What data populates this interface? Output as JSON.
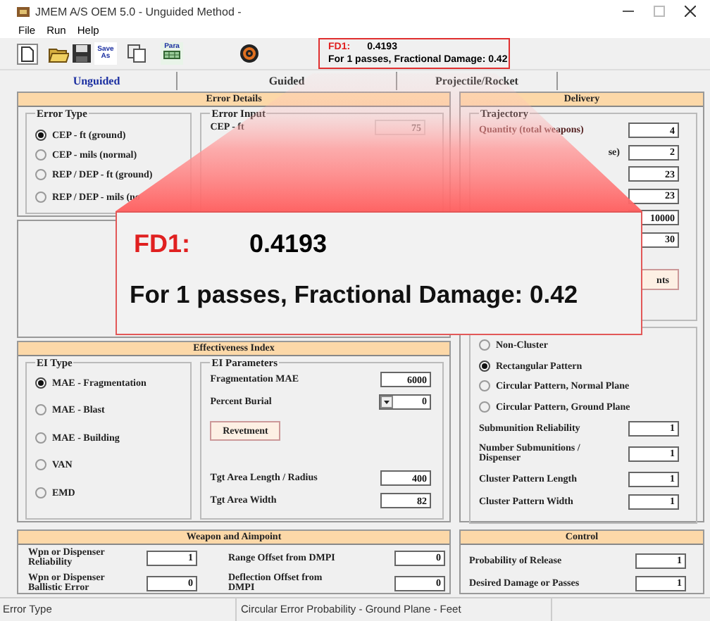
{
  "window": {
    "title": "JMEM A/S OEM 5.0 - Unguided Method -"
  },
  "menu": [
    "File",
    "Run",
    "Help"
  ],
  "toolbar": {
    "save_as_label": "Save As",
    "para_label": "Para"
  },
  "result_box": {
    "label": "FD1:",
    "value": "0.4193",
    "summary": "For 1 passes, Fractional Damage: 0.42"
  },
  "tabs": [
    {
      "label": "Unguided",
      "selected": true
    },
    {
      "label": "Guided",
      "selected": false
    },
    {
      "label": "Projectile/Rocket",
      "selected": false
    }
  ],
  "error_details": {
    "title": "Error Details",
    "error_type": {
      "title": "Error Type",
      "options": [
        {
          "label": "CEP - ft (ground)",
          "selected": true
        },
        {
          "label": "CEP - mils (normal)",
          "selected": false
        },
        {
          "label": "REP / DEP - ft (ground)",
          "selected": false
        },
        {
          "label": "REP / DEP - mils (no",
          "selected": false
        }
      ]
    },
    "error_input": {
      "title": "Error Input",
      "label": "CEP - ft",
      "value": "75",
      "disabled": true
    }
  },
  "delivery": {
    "title": "Delivery",
    "trajectory": {
      "title": "Trajectory",
      "fields": [
        {
          "label": "Quantity (total weapons)",
          "value": "4"
        },
        {
          "label": "se)",
          "value": "2"
        },
        {
          "value": "23"
        },
        {
          "value": "23"
        },
        {
          "value": "10000"
        },
        {
          "value": "30"
        }
      ]
    },
    "button": "nts",
    "pattern": {
      "options": [
        {
          "label": "Non-Cluster",
          "selected": false
        },
        {
          "label": "Rectangular Pattern",
          "selected": true
        },
        {
          "label": "Circular Pattern, Normal Plane",
          "selected": false
        },
        {
          "label": "Circular Pattern, Ground Plane",
          "selected": false
        }
      ],
      "fields": [
        {
          "label": "Submunition Reliability",
          "value": "1"
        },
        {
          "label": "Number Submunitions / Dispenser",
          "value": "1"
        },
        {
          "label": "Cluster Pattern Length",
          "value": "1"
        },
        {
          "label": "Cluster Pattern Width",
          "value": "1"
        }
      ]
    }
  },
  "effectiveness_index": {
    "title": "Effectiveness Index",
    "ei_type": {
      "title": "EI Type",
      "options": [
        {
          "label": "MAE - Fragmentation",
          "selected": true
        },
        {
          "label": "MAE - Blast",
          "selected": false
        },
        {
          "label": "MAE - Building",
          "selected": false
        },
        {
          "label": "VAN",
          "selected": false
        },
        {
          "label": "EMD",
          "selected": false
        }
      ]
    },
    "ei_parameters": {
      "title": "EI Parameters",
      "fragmentation": {
        "label": "Fragmentation MAE",
        "value": "6000"
      },
      "burial": {
        "label": "Percent Burial",
        "value": "0"
      },
      "button": "Revetment",
      "fields": [
        {
          "label": "Tgt Area Length / Radius",
          "value": "400"
        },
        {
          "label": "Tgt Area Width",
          "value": "82"
        }
      ]
    }
  },
  "weapon_aimpoint": {
    "title": "Weapon and Aimpoint",
    "fields": [
      {
        "label": "Wpn or Dispenser Reliability",
        "value": "1"
      },
      {
        "label": "Range Offset from DMPI",
        "value": "0"
      },
      {
        "label": "Wpn or Dispenser Ballistic Error",
        "value": "0"
      },
      {
        "label": "Deflection Offset from DMPI",
        "value": "0"
      }
    ]
  },
  "control": {
    "title": "Control",
    "fields": [
      {
        "label": "Probability of Release",
        "value": "1"
      },
      {
        "label": "Desired Damage or Passes",
        "value": "1"
      }
    ]
  },
  "status_bar": [
    "Error Type",
    "Circular Error Probability - Ground Plane - Feet"
  ],
  "callout": {
    "label": "FD1:",
    "value": "0.4193",
    "summary": "For 1 passes, Fractional Damage: 0.42"
  }
}
